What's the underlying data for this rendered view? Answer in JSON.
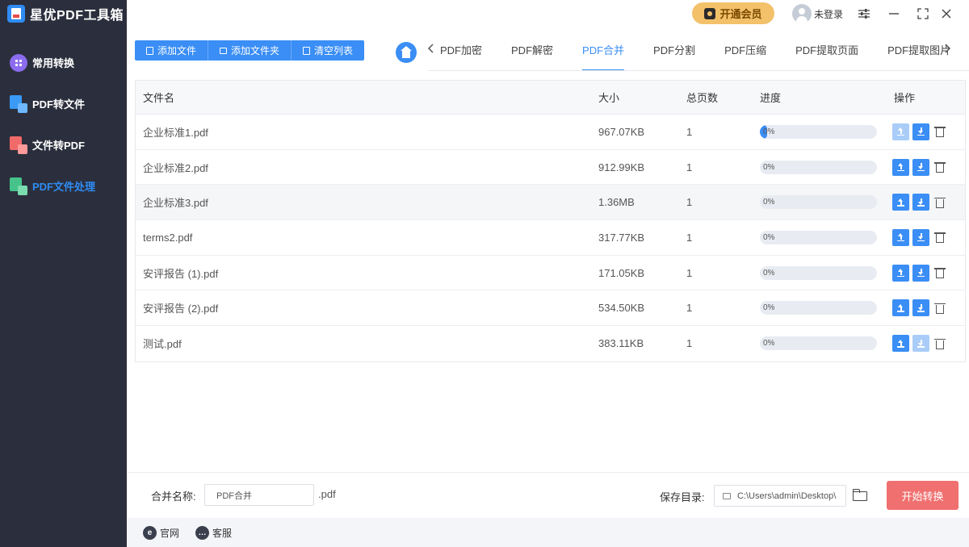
{
  "app": {
    "title": "星优PDF工具箱"
  },
  "sidebar": {
    "items": [
      {
        "label": "常用转换",
        "icon": "grid-icon",
        "active": false
      },
      {
        "label": "PDF转文件",
        "icon": "pdf-to-file-icon",
        "active": false
      },
      {
        "label": "文件转PDF",
        "icon": "file-to-pdf-icon",
        "active": false
      },
      {
        "label": "PDF文件处理",
        "icon": "pdf-process-icon",
        "active": true
      }
    ]
  },
  "topbar": {
    "vip_label": "开通会员",
    "login_label": "未登录"
  },
  "toolbar": {
    "add_file": "添加文件",
    "add_folder": "添加文件夹",
    "clear_list": "清空列表"
  },
  "tabs": [
    {
      "label": "PDF加密",
      "active": false
    },
    {
      "label": "PDF解密",
      "active": false
    },
    {
      "label": "PDF合并",
      "active": true
    },
    {
      "label": "PDF分割",
      "active": false
    },
    {
      "label": "PDF压缩",
      "active": false
    },
    {
      "label": "PDF提取页面",
      "active": false
    },
    {
      "label": "PDF提取图片",
      "active": false
    }
  ],
  "table": {
    "headers": {
      "name": "文件名",
      "size": "大小",
      "pages": "总页数",
      "progress": "进度",
      "actions": "操作"
    },
    "rows": [
      {
        "name": "企业标准1.pdf",
        "size": "967.07KB",
        "pages": "1",
        "progress": "0%",
        "fill": 0.06,
        "up_disabled": true,
        "down_disabled": false
      },
      {
        "name": "企业标准2.pdf",
        "size": "912.99KB",
        "pages": "1",
        "progress": "0%",
        "fill": 0,
        "up_disabled": false,
        "down_disabled": false
      },
      {
        "name": "企业标准3.pdf",
        "size": "1.36MB",
        "pages": "1",
        "progress": "0%",
        "fill": 0,
        "up_disabled": false,
        "down_disabled": false
      },
      {
        "name": "terms2.pdf",
        "size": "317.77KB",
        "pages": "1",
        "progress": "0%",
        "fill": 0,
        "up_disabled": false,
        "down_disabled": false
      },
      {
        "name": "安评报告 (1).pdf",
        "size": "171.05KB",
        "pages": "1",
        "progress": "0%",
        "fill": 0,
        "up_disabled": false,
        "down_disabled": false
      },
      {
        "name": "安评报告 (2).pdf",
        "size": "534.50KB",
        "pages": "1",
        "progress": "0%",
        "fill": 0,
        "up_disabled": false,
        "down_disabled": false
      },
      {
        "name": "测试.pdf",
        "size": "383.11KB",
        "pages": "1",
        "progress": "0%",
        "fill": 0,
        "up_disabled": false,
        "down_disabled": true
      }
    ]
  },
  "bottom": {
    "merge_label": "合并名称:",
    "merge_value": "PDF合并",
    "merge_ext": ".pdf",
    "save_label": "保存目录:",
    "save_path": "C:\\Users\\admin\\Desktop\\",
    "start_label": "开始转换"
  },
  "footer": {
    "website": "官网",
    "service": "客服"
  }
}
